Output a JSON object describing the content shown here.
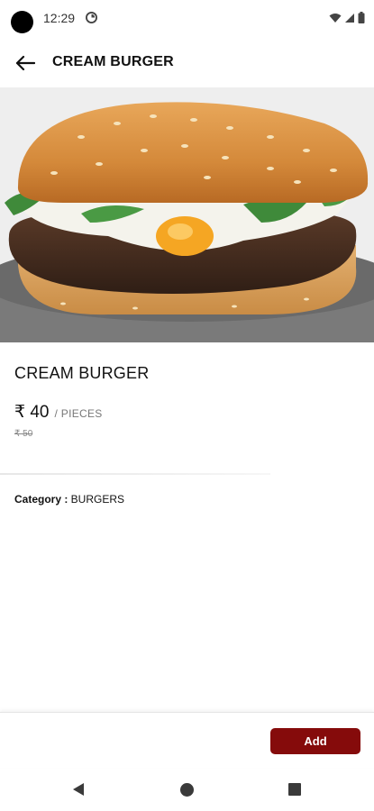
{
  "status_bar": {
    "time": "12:29",
    "icons": [
      "app-notification-icon",
      "wifi-icon",
      "signal-icon",
      "battery-icon"
    ]
  },
  "app_bar": {
    "title": "CREAM BURGER",
    "back_icon": "arrow-left-icon"
  },
  "product": {
    "name": "CREAM BURGER",
    "price": "₹ 40",
    "unit": "/ PIECES",
    "old_price": "₹ 50",
    "category_label": "Category :",
    "category_value": " BURGERS",
    "image_icon": "burger-photo"
  },
  "actions": {
    "add_label": "Add"
  },
  "nav": {
    "icons": [
      "back-triangle-icon",
      "home-circle-icon",
      "recents-square-icon"
    ]
  },
  "colors": {
    "accent": "#850b0b",
    "text": "#111111",
    "muted": "#777777"
  }
}
